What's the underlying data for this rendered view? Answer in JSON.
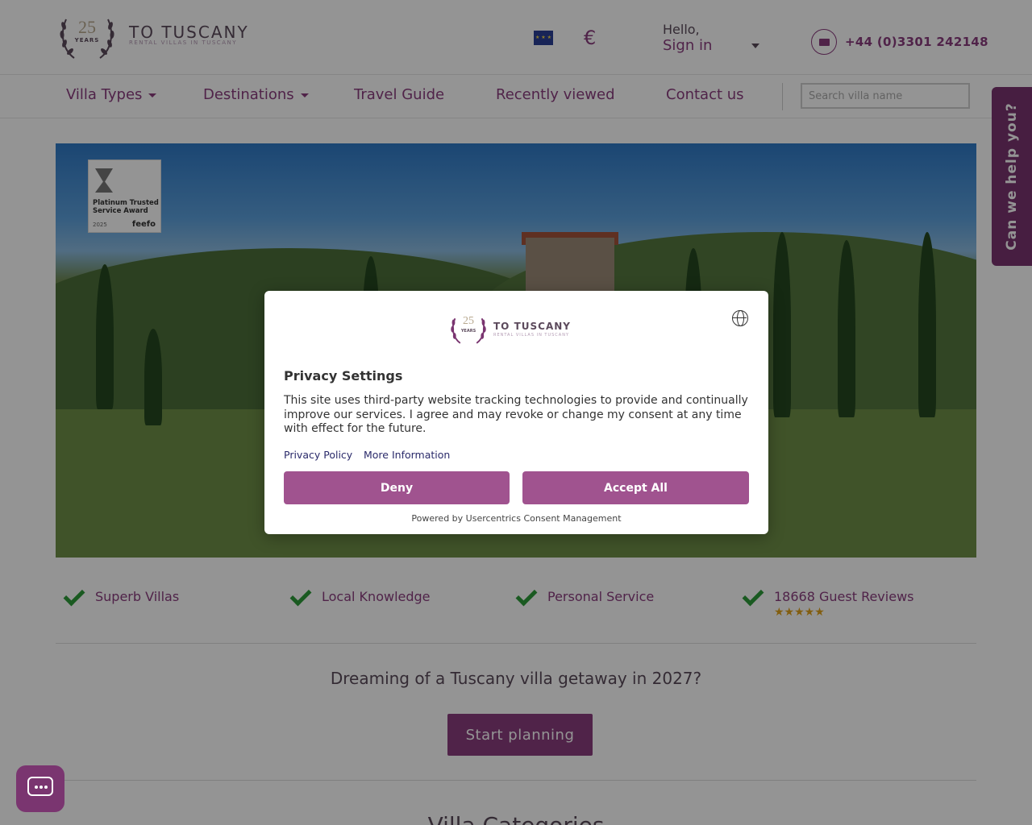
{
  "header": {
    "logo": {
      "years_number": "25",
      "years_label": "YEARS",
      "brand": "TO TUSCANY",
      "tagline": "RENTAL VILLAS IN TUSCANY"
    },
    "currency_symbol": "€",
    "greeting": "Hello,",
    "signin_label": "Sign in",
    "phone": "+44 (0)3301 242148"
  },
  "nav": {
    "items": [
      {
        "label": "Villa Types"
      },
      {
        "label": "Destinations"
      },
      {
        "label": "Travel Guide"
      },
      {
        "label": "Recently viewed"
      },
      {
        "label": "Contact us"
      }
    ],
    "search_placeholder": "Search villa name"
  },
  "help_tab": "Can we help you?",
  "hero": {
    "award": {
      "title": "Platinum Trusted Service Award",
      "year": "2025",
      "brand": "feefo"
    }
  },
  "features": [
    {
      "label": "Superb Villas"
    },
    {
      "label": "Local Knowledge"
    },
    {
      "label": "Personal Service"
    },
    {
      "label": "18668 Guest Reviews"
    }
  ],
  "rating_stars": "★★★★★",
  "cta": {
    "text": "Dreaming of a Tuscany villa getaway in 2027?",
    "button": "Start planning"
  },
  "next_section_title": "Villa Categories",
  "consent": {
    "logo": {
      "years_number": "25",
      "years_label": "YEARS",
      "brand": "TO TUSCANY",
      "tagline": "RENTAL VILLAS IN TUSCANY"
    },
    "title": "Privacy Settings",
    "body": "This site uses third-party website tracking technologies to provide and continually improve our services. I agree and may revoke or change my consent at any time with effect for the future.",
    "privacy_policy_link": "Privacy Policy",
    "more_info_link": "More Information",
    "deny_button": "Deny",
    "accept_button": "Accept All",
    "powered_by": "Powered by Usercentrics Consent Management"
  },
  "colors": {
    "brand_purple": "#8a3d7f",
    "consent_button": "#a0538f",
    "check_green": "#2e9c3a",
    "star_gold": "#e0a31d"
  }
}
